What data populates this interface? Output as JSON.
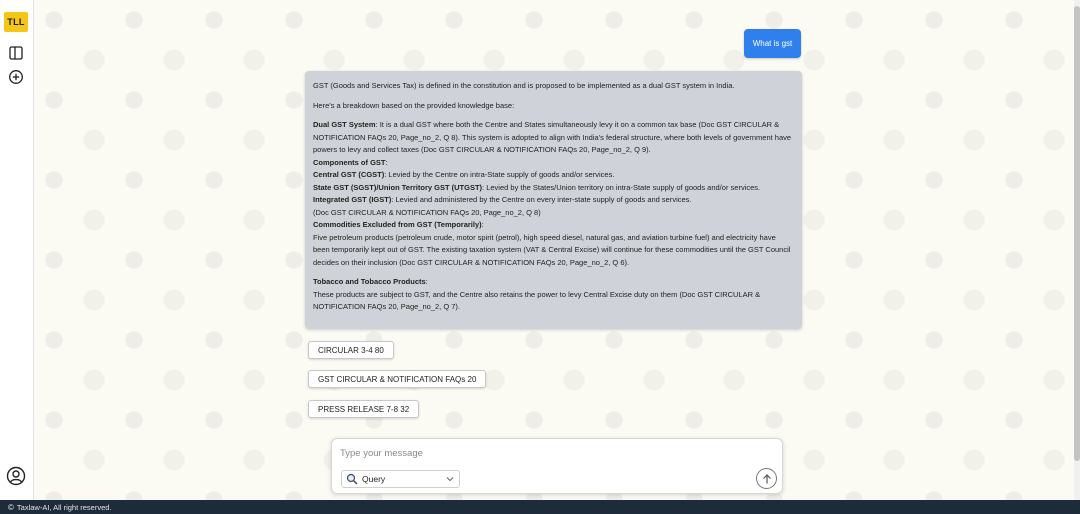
{
  "app": {
    "logo_text": "TLL",
    "brand_color": "#f5c518",
    "accent_color": "#2f80ed"
  },
  "sidebar": {
    "icons": [
      "panel-toggle-icon",
      "new-chat-icon",
      "user-profile-icon"
    ]
  },
  "chat": {
    "user_message": "What is gst",
    "answer": {
      "intro": "GST (Goods and Services Tax) is defined in the constitution and is proposed to be implemented as a dual GST system in India.",
      "breakdown_intro": "Here's a breakdown based on the provided knowledge base:",
      "dual_title": "Dual GST System",
      "dual_text": ": It is a dual GST where both the Centre and States simultaneously levy it on a common tax base (Doc GST CIRCULAR & NOTIFICATION FAQs 20, Page_no_2, Q 8). This system is adopted to align with India's federal structure, where both levels of government have powers to levy and collect taxes (Doc GST CIRCULAR & NOTIFICATION FAQs 20, Page_no_2, Q 9).",
      "components_title": "Components of GST",
      "components_colon": ":",
      "cgst_title": "Central GST (CGST)",
      "cgst_text": ": Levied by the Centre on intra-State supply of goods and/or services.",
      "sgst_title": "State GST (SGST)/Union Territory GST (UTGST)",
      "sgst_text": ": Levied by the States/Union territory on intra-State supply of goods and/or services.",
      "igst_title": "Integrated GST (IGST)",
      "igst_text": ": Levied and administered by the Centre on every inter-state supply of goods and services.",
      "igst_ref": "(Doc GST CIRCULAR & NOTIFICATION FAQs 20, Page_no_2, Q 8)",
      "excluded_title": "Commodities Excluded from GST (Temporarily)",
      "excluded_colon": ":",
      "excluded_text": "Five petroleum products (petroleum crude, motor spirit (petrol), high speed diesel, natural gas, and aviation turbine fuel) and electricity have been temporarily kept out of GST. The existing taxation system (VAT & Central Excise) will continue for these commodities until the GST Council decides on their inclusion (Doc GST CIRCULAR & NOTIFICATION FAQs 20, Page_no_2, Q 6).",
      "tobacco_title": "Tobacco and Tobacco Products",
      "tobacco_colon": ":",
      "tobacco_text": "These products are subject to GST, and the Centre also retains the power to levy Central Excise duty on them (Doc GST CIRCULAR & NOTIFICATION FAQs 20, Page_no_2, Q 7)."
    },
    "sources": [
      "CIRCULAR 3-4 80",
      "GST CIRCULAR & NOTIFICATION FAQs 20",
      "PRESS RELEASE 7-8 32"
    ]
  },
  "composer": {
    "placeholder": "Type your message",
    "mode_label": "Query"
  },
  "footer": {
    "copyright_symbol": "©",
    "text": "Taxlaw-AI, All right reserved."
  }
}
